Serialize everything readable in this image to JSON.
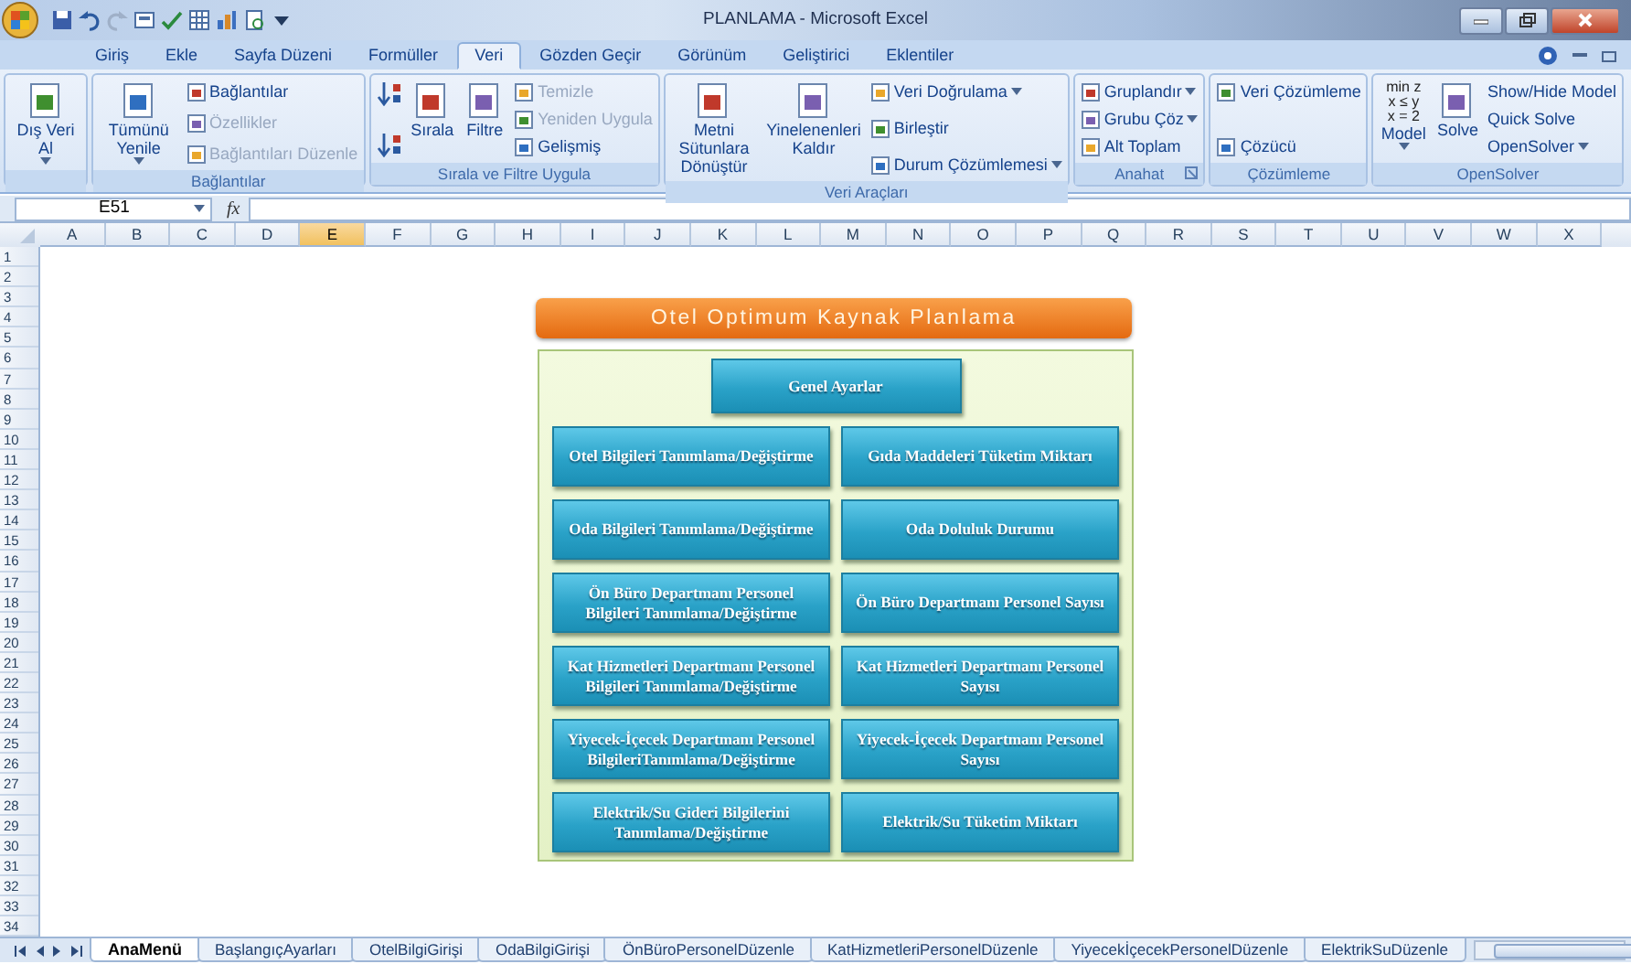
{
  "window": {
    "title": "PLANLAMA - Microsoft Excel"
  },
  "ribbon_tabs": [
    {
      "label": "Giriş",
      "selected": false
    },
    {
      "label": "Ekle",
      "selected": false
    },
    {
      "label": "Sayfa Düzeni",
      "selected": false
    },
    {
      "label": "Formüller",
      "selected": false
    },
    {
      "label": "Veri",
      "selected": true
    },
    {
      "label": "Gözden Geçir",
      "selected": false
    },
    {
      "label": "Görünüm",
      "selected": false
    },
    {
      "label": "Geliştirici",
      "selected": false
    },
    {
      "label": "Eklentiler",
      "selected": false
    }
  ],
  "ribbon_groups": [
    {
      "columns": [
        [
          {
            "kind": "large",
            "text": "Dış Veri Al",
            "dropdown": true,
            "disabled": false
          }
        ]
      ]
    },
    {
      "label": "Bağlantılar",
      "columns": [
        [
          {
            "kind": "large",
            "text": "Tümünü Yenile",
            "dropdown": true,
            "disabled": false
          }
        ],
        [
          {
            "kind": "small",
            "text": "Bağlantılar",
            "disabled": false
          },
          {
            "kind": "small",
            "text": "Özellikler",
            "disabled": true
          },
          {
            "kind": "small",
            "text": "Bağlantıları Düzenle",
            "disabled": true
          }
        ]
      ]
    },
    {
      "label": "Sırala ve Filtre Uygula",
      "columns": [
        [
          {
            "kind": "icon",
            "disabled": false
          },
          {
            "kind": "icon",
            "disabled": false
          }
        ],
        [
          {
            "kind": "large",
            "text": "Sırala",
            "disabled": false
          }
        ],
        [
          {
            "kind": "large",
            "text": "Filtre",
            "disabled": false
          }
        ],
        [
          {
            "kind": "small",
            "text": "Temizle",
            "disabled": true
          },
          {
            "kind": "small",
            "text": "Yeniden Uygula",
            "disabled": true
          },
          {
            "kind": "small",
            "text": "Gelişmiş",
            "disabled": false
          }
        ]
      ]
    },
    {
      "label": "Veri Araçları",
      "columns": [
        [
          {
            "kind": "large",
            "text": "Metni Sütunlara Dönüştür",
            "disabled": false
          }
        ],
        [
          {
            "kind": "large",
            "text": "Yinelenenleri Kaldır",
            "disabled": false
          }
        ],
        [
          {
            "kind": "small",
            "text": "Veri Doğrulama",
            "dropdown": true,
            "disabled": false
          },
          {
            "kind": "small",
            "text": "Birleştir",
            "disabled": false
          },
          {
            "kind": "small",
            "text": "Durum Çözümlemesi",
            "dropdown": true,
            "disabled": false
          }
        ]
      ]
    },
    {
      "label": "Anahat",
      "launcher": true,
      "columns": [
        [
          {
            "kind": "small",
            "text": "Gruplandır",
            "dropdown": true,
            "disabled": false
          },
          {
            "kind": "small",
            "text": "Grubu Çöz",
            "dropdown": true,
            "disabled": false
          },
          {
            "kind": "small",
            "text": "Alt Toplam",
            "disabled": false
          }
        ]
      ]
    },
    {
      "label": "Çözümleme",
      "columns": [
        [
          {
            "kind": "small",
            "text": "Veri Çözümleme",
            "disabled": false
          },
          {
            "kind": "small",
            "text": "Çözücü",
            "disabled": false
          }
        ]
      ]
    },
    {
      "label": "OpenSolver",
      "columns": [
        [
          {
            "kind": "formula",
            "icon_text": [
              "min z",
              "x ≤ y",
              "x = 2"
            ],
            "text": "Model",
            "dropdown": true,
            "disabled": false
          }
        ],
        [
          {
            "kind": "large",
            "text": "Solve",
            "disabled": false
          }
        ],
        [
          {
            "kind": "plain",
            "text": "Show/Hide Model",
            "disabled": false
          },
          {
            "kind": "plain",
            "text": "Quick Solve",
            "disabled": false
          },
          {
            "kind": "plain",
            "text": "OpenSolver",
            "dropdown": true,
            "disabled": false
          }
        ]
      ]
    }
  ],
  "formula_bar": {
    "name_box": "E51",
    "function_label": "fx"
  },
  "columns": [
    {
      "label": "A",
      "selected": false
    },
    {
      "label": "B",
      "selected": false
    },
    {
      "label": "C",
      "selected": false
    },
    {
      "label": "D",
      "selected": false
    },
    {
      "label": "E",
      "selected": true
    },
    {
      "label": "F",
      "selected": false
    },
    {
      "label": "G",
      "selected": false
    },
    {
      "label": "H",
      "selected": false
    },
    {
      "label": "I",
      "selected": false
    },
    {
      "label": "J",
      "selected": false
    },
    {
      "label": "K",
      "selected": false
    },
    {
      "label": "L",
      "selected": false
    },
    {
      "label": "M",
      "selected": false
    },
    {
      "label": "N",
      "selected": false
    },
    {
      "label": "O",
      "selected": false
    },
    {
      "label": "P",
      "selected": false
    },
    {
      "label": "Q",
      "selected": false
    },
    {
      "label": "R",
      "selected": false
    },
    {
      "label": "S",
      "selected": false
    },
    {
      "label": "T",
      "selected": false
    },
    {
      "label": "U",
      "selected": false
    },
    {
      "label": "V",
      "selected": false
    },
    {
      "label": "W",
      "selected": false
    },
    {
      "label": "X",
      "selected": false
    }
  ],
  "rows": [
    "1",
    "2",
    "3",
    "4",
    "5",
    "6",
    "7",
    "8",
    "9",
    "10",
    "11",
    "12",
    "13",
    "14",
    "15",
    "16",
    "17",
    "18",
    "19",
    "20",
    "21",
    "22",
    "23",
    "24",
    "25",
    "26",
    "27",
    "28",
    "29",
    "30",
    "31",
    "32",
    "33",
    "34"
  ],
  "menu": {
    "title": "Otel Optimum Kaynak Planlama",
    "top_button": "Genel Ayarlar",
    "button_rows": [
      [
        "Otel Bilgileri Tanımlama/Değiştirme",
        "Gıda Maddeleri  Tüketim Miktarı"
      ],
      [
        "Oda Bilgileri Tanımlama/Değiştirme",
        "Oda  Doluluk Durumu"
      ],
      [
        "Ön Büro Departmanı Personel Bilgileri Tanımlama/Değiştirme",
        "Ön Büro Departmanı Personel Sayısı"
      ],
      [
        "Kat Hizmetleri Departmanı Personel Bilgileri Tanımlama/Değiştirme",
        "Kat Hizmetleri Departmanı Personel Sayısı"
      ],
      [
        "Yiyecek-İçecek Departmanı Personel BilgileriTanımlama/Değiştirme",
        "Yiyecek-İçecek Departmanı Personel Sayısı"
      ],
      [
        "Elektrik/Su Gideri Bilgilerini Tanımlama/Değiştirme",
        "Elektrik/Su Tüketim Miktarı"
      ]
    ]
  },
  "sheet_tabs": [
    {
      "label": "AnaMenü",
      "selected": true
    },
    {
      "label": "BaşlangıçAyarları",
      "selected": false
    },
    {
      "label": "OtelBilgiGirişi",
      "selected": false
    },
    {
      "label": "OdaBilgiGirişi",
      "selected": false
    },
    {
      "label": "ÖnBüroPersonelDüzenle",
      "selected": false
    },
    {
      "label": "KatHizmetleriPersonelDüzenle",
      "selected": false
    },
    {
      "label": "YiyecekİçecekPersonelDüzenle",
      "selected": false
    },
    {
      "label": "ElektrikSuDüzenle",
      "selected": false
    }
  ]
}
